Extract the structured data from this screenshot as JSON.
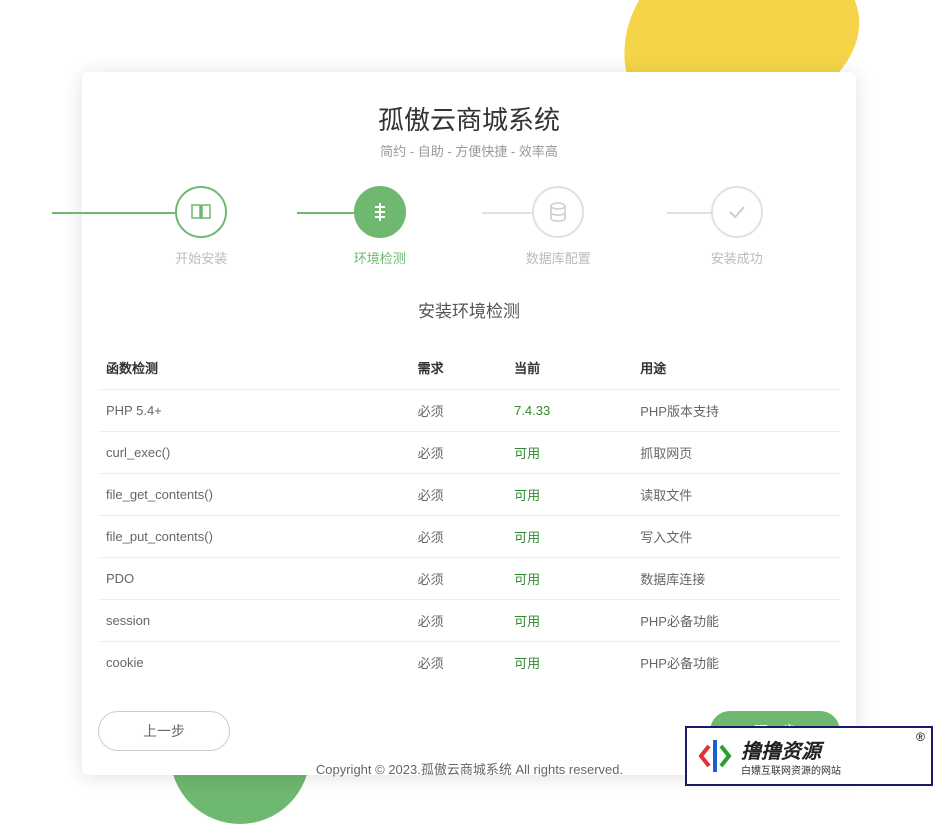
{
  "header": {
    "title": "孤傲云商城系统",
    "subtitle": "简约 - 自助 - 方便快捷 - 效率高"
  },
  "steps": [
    {
      "label": "开始安装",
      "icon": "book-icon"
    },
    {
      "label": "环境检测",
      "icon": "env-icon"
    },
    {
      "label": "数据库配置",
      "icon": "database-icon"
    },
    {
      "label": "安装成功",
      "icon": "check-icon"
    }
  ],
  "section_title": "安装环境检测",
  "table": {
    "headers": {
      "name": "函数检测",
      "req": "需求",
      "cur": "当前",
      "use": "用途"
    },
    "rows": [
      {
        "name": "PHP 5.4+",
        "req": "必须",
        "cur": "7.4.33",
        "use": "PHP版本支持"
      },
      {
        "name": "curl_exec()",
        "req": "必须",
        "cur": "可用",
        "use": "抓取网页"
      },
      {
        "name": "file_get_contents()",
        "req": "必须",
        "cur": "可用",
        "use": "读取文件"
      },
      {
        "name": "file_put_contents()",
        "req": "必须",
        "cur": "可用",
        "use": "写入文件"
      },
      {
        "name": "PDO",
        "req": "必须",
        "cur": "可用",
        "use": "数据库连接"
      },
      {
        "name": "session",
        "req": "必须",
        "cur": "可用",
        "use": "PHP必备功能"
      },
      {
        "name": "cookie",
        "req": "必须",
        "cur": "可用",
        "use": "PHP必备功能"
      }
    ]
  },
  "buttons": {
    "prev": "上一步",
    "next": "下一步"
  },
  "footer": "Copyright © 2023.孤傲云商城系统 All rights reserved.",
  "watermark": {
    "main": "撸撸资源",
    "sub": "白嫖互联网资源的网站"
  }
}
